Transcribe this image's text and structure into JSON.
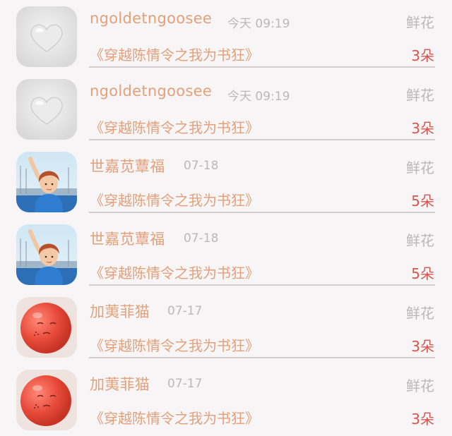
{
  "records": [
    {
      "avatar": "heart-stone-avatar",
      "username": "ngoldetngoosee",
      "time": "今天 09:19",
      "gift": "鲜花",
      "book": "《穿越陈情令之我为书狂》",
      "count": "3朵"
    },
    {
      "avatar": "heart-stone-avatar",
      "username": "ngoldetngoosee",
      "time": "今天 09:19",
      "gift": "鲜花",
      "book": "《穿越陈情令之我为书狂》",
      "count": "3朵"
    },
    {
      "avatar": "girl-photo-avatar",
      "username": "世嘉苋蕈福",
      "time": "07-18",
      "gift": "鲜花",
      "book": "《穿越陈情令之我为书狂》",
      "count": "5朵"
    },
    {
      "avatar": "girl-photo-avatar",
      "username": "世嘉苋蕈福",
      "time": "07-18",
      "gift": "鲜花",
      "book": "《穿越陈情令之我为书狂》",
      "count": "5朵"
    },
    {
      "avatar": "red-balloon-avatar",
      "username": "加荑菲猫",
      "time": "07-17",
      "gift": "鲜花",
      "book": "《穿越陈情令之我为书狂》",
      "count": "3朵"
    },
    {
      "avatar": "red-balloon-avatar",
      "username": "加荑菲猫",
      "time": "07-17",
      "gift": "鲜花",
      "book": "《穿越陈情令之我为书狂》",
      "count": "3朵"
    }
  ],
  "colors": {
    "username": "#e3a07a",
    "book_title": "#e3a07a",
    "count": "#d9534f",
    "time": "#b9b9b9",
    "gift": "#b8b8b8",
    "background": "#f7f5f6"
  }
}
